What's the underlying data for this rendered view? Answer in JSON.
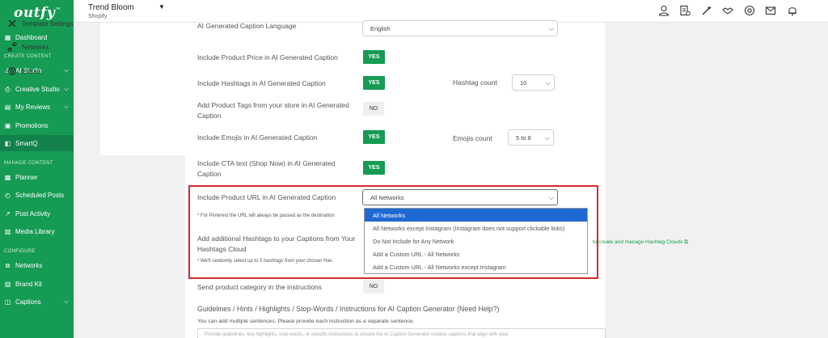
{
  "app": {
    "logo_text": "outfy",
    "logo_mark": "™",
    "store_name": "Trend Bloom",
    "store_platform": "Shopify"
  },
  "sidebar": {
    "sections": {
      "create_content": "CREATE CONTENT",
      "manage_content": "MANAGE CONTENT",
      "configure": "CONFIGURE"
    },
    "items": [
      {
        "label": "Dashboard",
        "icon": "dashboard-icon"
      },
      {
        "label": "AI Studio",
        "icon": "ai-studio-icon"
      },
      {
        "label": "Creative Studio",
        "icon": "creative-studio-icon"
      },
      {
        "label": "My Reviews",
        "icon": "reviews-icon"
      },
      {
        "label": "Promotions",
        "icon": "promotions-icon"
      },
      {
        "label": "SmartQ",
        "icon": "smartq-icon"
      },
      {
        "label": "Planner",
        "icon": "planner-icon"
      },
      {
        "label": "Scheduled Posts",
        "icon": "scheduled-posts-icon"
      },
      {
        "label": "Post Activity",
        "icon": "post-activity-icon"
      },
      {
        "label": "Media Library",
        "icon": "media-library-icon"
      },
      {
        "label": "Networks",
        "icon": "networks-icon"
      },
      {
        "label": "Brand Kit",
        "icon": "brand-kit-icon"
      },
      {
        "label": "Captions",
        "icon": "captions-icon"
      }
    ]
  },
  "subnav": {
    "items": [
      {
        "label": "Template Settings",
        "icon": "template-settings-icon"
      },
      {
        "label": "Networks",
        "icon": "networks-icon"
      },
      {
        "label": "Extras",
        "icon": "extras-icon"
      }
    ]
  },
  "form": {
    "caption_language_label": "AI Generated Caption Language",
    "caption_language_value": "English",
    "price_label": "Include Product Price in AI Generated Caption",
    "price_value": "YES",
    "hashtags_label": "Include Hashtags in AI Generated Caption",
    "hashtags_value": "YES",
    "hashtag_count_label": "Hashtag count",
    "hashtag_count_value": "10",
    "tags_label": "Add Product Tags from your store in AI Generated Caption",
    "tags_value": "NO",
    "emojis_label": "Include Emojis in AI Generated Caption",
    "emojis_value": "YES",
    "emojis_count_label": "Emojis count",
    "emojis_count_value": "5 to 8",
    "cta_label": "Include CTA text (Shop Now) in AI Generated Caption",
    "cta_value": "YES",
    "url_label": "Include Product URL in AI Generated Caption",
    "url_value": "All Networks",
    "url_note": "* For Pinterest the URL will always be passed as the destination",
    "cloud_label": "Add additional Hashtags to your Captions from Your Hashtags Cloud",
    "cloud_note": "* We'll randomly select up to 5 hashtags from your chosen Has",
    "cloud_link": "to create and manage Hashtag Clouds",
    "category_label": "Send product category in the instructions",
    "category_value": "NO",
    "guidelines_label": "Guidelines / Hints / Highlights / Stop-Words / Instructions for AI Caption Generator (Need Help?)",
    "guidelines_hint": "You can add multiple sentences. Please provide each instruction as a separate sentence.",
    "guidelines_placeholder": "Provide guidelines, key highlights, stop-words, or specific instructions to ensure the AI Caption Generator creates captions that align with your"
  },
  "url_dropdown": {
    "options": [
      "All Networks",
      "All Networks except Instagram (Instagram does not support clickable links)",
      "Do Not Include for Any Network",
      "Add a Custom URL - All Networks",
      "Add a Custom URL - All Networks except Instagram"
    ],
    "selected_index": 0
  },
  "colors": {
    "brand_green": "#169b54",
    "highlight_red": "#d9282e",
    "selection_blue": "#1f69d3"
  },
  "topbar_icons": [
    "user-icon",
    "billing-icon",
    "magic-icon",
    "handshake-icon",
    "support-icon",
    "inbox-icon",
    "notifications-icon"
  ]
}
